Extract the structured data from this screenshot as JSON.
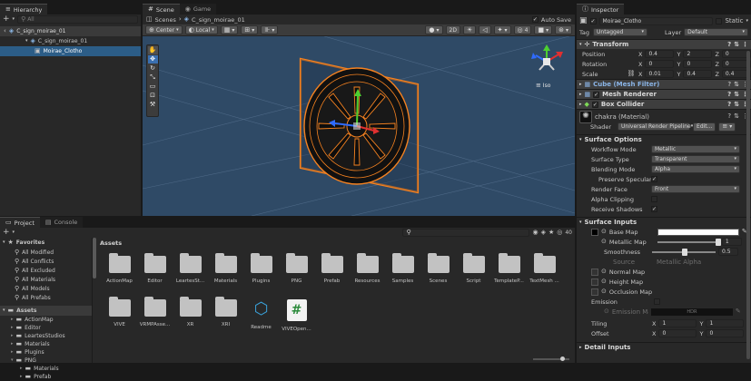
{
  "hierarchy": {
    "tab": "Hierarchy",
    "search_placeholder": "All",
    "scene": "C_sign_moirae_01",
    "prefab": "C_sign_moirae_01",
    "child": "Moirae_Clotho"
  },
  "scene_view": {
    "tab_scene": "Scene",
    "tab_game": "Game",
    "breadcrumb_root": "Scenes",
    "breadcrumb_current": "C_sign_moirae_01",
    "auto_save": "Auto Save",
    "pivot": "Center",
    "space": "Local",
    "mode_2d": "2D",
    "gizmo_label": "Iso",
    "accent": "#f58220"
  },
  "inspector": {
    "tab": "Inspector",
    "object_name": "Moirae_Clotho",
    "static_label": "Static",
    "tag_label": "Tag",
    "tag_value": "Untagged",
    "layer_label": "Layer",
    "layer_value": "Default",
    "transform": {
      "title": "Transform",
      "position": {
        "label": "Position",
        "x": "0.4",
        "y": "2",
        "z": "0"
      },
      "rotation": {
        "label": "Rotation",
        "x": "0",
        "y": "0",
        "z": "0"
      },
      "scale": {
        "label": "Scale",
        "x": "0.01",
        "y": "0.4",
        "z": "0.4"
      }
    },
    "mesh_filter": "Cube (Mesh Filter)",
    "mesh_renderer": "Mesh Renderer",
    "box_collider": "Box Collider",
    "material_name": "chakra (Material)",
    "shader_label": "Shader",
    "shader_value": "Universal Render Pipeline",
    "edit_label": "Edit...",
    "surface_options": {
      "title": "Surface Options",
      "rows": [
        {
          "label": "Workflow Mode",
          "value": "Metallic"
        },
        {
          "label": "Surface Type",
          "value": "Transparent"
        },
        {
          "label": "Blending Mode",
          "value": "Alpha"
        }
      ],
      "preserve_specular": "Preserve Specular L",
      "render_face_label": "Render Face",
      "render_face_value": "Front",
      "alpha_clipping": "Alpha Clipping",
      "receive_shadows": "Receive Shadows"
    },
    "surface_inputs": {
      "title": "Surface Inputs",
      "base_map": "Base Map",
      "metallic_map": "Metallic Map",
      "metallic_value": "1",
      "smoothness": "Smoothness",
      "smoothness_value": "0.5",
      "source_label": "Source",
      "source_value": "Metallic Alpha",
      "normal_map": "Normal Map",
      "height_map": "Height Map",
      "occlusion_map": "Occlusion Map",
      "emission": "Emission",
      "emission_map": "Emission Ma",
      "emission_hdr": "HDR",
      "tiling_label": "Tiling",
      "tiling_x": "1",
      "tiling_y": "1",
      "offset_label": "Offset",
      "offset_x": "0",
      "offset_y": "0"
    },
    "detail_inputs": "Detail Inputs"
  },
  "project": {
    "tab_project": "Project",
    "tab_console": "Console",
    "count": "40",
    "favorites_title": "Favorites",
    "favorites": [
      "All Modified",
      "All Conflicts",
      "All Excluded",
      "All Materials",
      "All Models",
      "All Prefabs"
    ],
    "assets_title": "Assets",
    "tree": [
      "ActionMap",
      "Editor",
      "LeartesStudios",
      "Materials",
      "Plugins",
      "PNG",
      "Materials",
      "Prefab"
    ],
    "breadcrumb": "Assets",
    "grid_row1": [
      "ActionMap",
      "Editor",
      "LeartesSt...",
      "Materials",
      "Plugins",
      "PNG",
      "Prefab",
      "Resources",
      "Samples",
      "Scenes",
      "Script",
      "TemplateP...",
      "TextMesh ..."
    ],
    "grid_row2": [
      "VIVE",
      "VRMPAsse...",
      "XR",
      "XRI",
      "Readme",
      "VIVEOpen..."
    ]
  }
}
